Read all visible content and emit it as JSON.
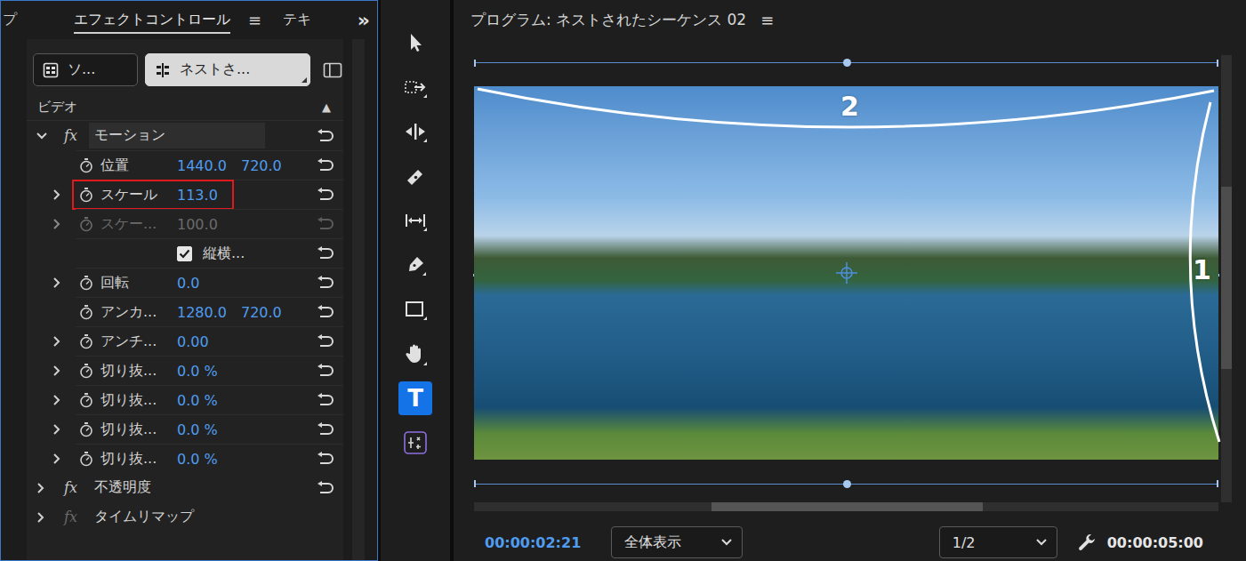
{
  "effect_controls": {
    "tabs": [
      {
        "label": "プ",
        "selected": false
      },
      {
        "label": "エフェクトコントロール",
        "selected": true
      },
      {
        "label": "テキ",
        "selected": false
      }
    ],
    "menu_icon": "≡",
    "overflow_icon": "»",
    "clip_buttons": [
      {
        "label": "ソ...",
        "selected": false
      },
      {
        "label": "ネストさ...",
        "selected": true
      }
    ],
    "section": {
      "label": "ビデオ",
      "toggle": "▲"
    },
    "rows": [
      {
        "kind": "effect",
        "fx": "fx",
        "label": "モーション",
        "fx_enabled": true,
        "expanded": true,
        "selected": true,
        "resettable": true
      },
      {
        "kind": "property",
        "label": "位置",
        "values": [
          "1440.0",
          "720.0"
        ],
        "expandable": false,
        "disabled": false,
        "highlighted": false
      },
      {
        "kind": "property",
        "label": "スケール",
        "values": [
          "113.0"
        ],
        "expandable": true,
        "disabled": false,
        "highlighted": true
      },
      {
        "kind": "property",
        "label": "スケー...",
        "values": [
          "100.0"
        ],
        "expandable": true,
        "disabled": true,
        "highlighted": false
      },
      {
        "kind": "checkbox",
        "label": "縦横...",
        "checked": true
      },
      {
        "kind": "property",
        "label": "回転",
        "values": [
          "0.0"
        ],
        "expandable": true,
        "disabled": false,
        "highlighted": false
      },
      {
        "kind": "property",
        "label": "アンカ...",
        "values": [
          "1280.0",
          "720.0"
        ],
        "expandable": false,
        "disabled": false,
        "highlighted": false
      },
      {
        "kind": "property",
        "label": "アンチ...",
        "values": [
          "0.00"
        ],
        "expandable": true,
        "disabled": false,
        "highlighted": false
      },
      {
        "kind": "property",
        "label": "切り抜...",
        "values": [
          "0.0 %"
        ],
        "expandable": true,
        "disabled": false,
        "highlighted": false
      },
      {
        "kind": "property",
        "label": "切り抜...",
        "values": [
          "0.0 %"
        ],
        "expandable": true,
        "disabled": false,
        "highlighted": false
      },
      {
        "kind": "property",
        "label": "切り抜...",
        "values": [
          "0.0 %"
        ],
        "expandable": true,
        "disabled": false,
        "highlighted": false
      },
      {
        "kind": "property",
        "label": "切り抜...",
        "values": [
          "0.0 %"
        ],
        "expandable": true,
        "disabled": false,
        "highlighted": false
      },
      {
        "kind": "effect",
        "fx": "fx",
        "label": "不透明度",
        "fx_enabled": true,
        "expanded": false,
        "selected": false,
        "resettable": true
      },
      {
        "kind": "effect",
        "fx": "fx",
        "label": "タイムリマップ",
        "fx_enabled": false,
        "expanded": false,
        "selected": false,
        "resettable": false
      }
    ]
  },
  "tools": [
    {
      "kind": "selection",
      "selected": false
    },
    {
      "kind": "track-select",
      "selected": false
    },
    {
      "kind": "ripple",
      "selected": false
    },
    {
      "kind": "razor",
      "selected": false
    },
    {
      "kind": "slip",
      "selected": false
    },
    {
      "kind": "pen",
      "selected": false
    },
    {
      "kind": "rectangle",
      "selected": false
    },
    {
      "kind": "hand",
      "selected": false
    },
    {
      "kind": "type",
      "glyph": "T",
      "selected": true
    },
    {
      "kind": "generative-extend",
      "selected": false
    }
  ],
  "program_monitor": {
    "title": "プログラム: ネストされたシーケンス 02",
    "menu_icon": "≡",
    "annotations": [
      {
        "label": "1"
      },
      {
        "label": "2"
      }
    ],
    "timecode": "00:00:02:21",
    "zoom": "全体表示",
    "resolution": "1/2",
    "duration": "00:00:05:00"
  }
}
